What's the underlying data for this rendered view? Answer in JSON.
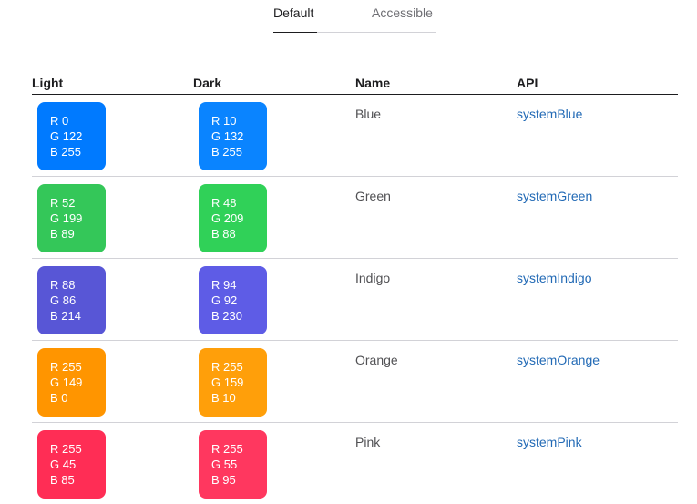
{
  "tabs": [
    {
      "label": "Default",
      "active": true
    },
    {
      "label": "Accessible",
      "active": false
    }
  ],
  "columns": {
    "light": "Light",
    "dark": "Dark",
    "name": "Name",
    "api": "API"
  },
  "colors": {
    "text_primary": "#1d1d1f",
    "text_secondary": "#515154",
    "link": "#2169b5",
    "divider": "#d2d2d7"
  },
  "rows": [
    {
      "name": "Blue",
      "api": "systemBlue",
      "light": {
        "hex": "#007aff",
        "r": "R 0",
        "g": "G 122",
        "b": "B 255"
      },
      "dark": {
        "hex": "#0a84ff",
        "r": "R 10",
        "g": "G 132",
        "b": "B 255"
      }
    },
    {
      "name": "Green",
      "api": "systemGreen",
      "light": {
        "hex": "#34c759",
        "r": "R 52",
        "g": "G 199",
        "b": "B 89"
      },
      "dark": {
        "hex": "#30d158",
        "r": "R 48",
        "g": "G 209",
        "b": "B 88"
      }
    },
    {
      "name": "Indigo",
      "api": "systemIndigo",
      "light": {
        "hex": "#5856d6",
        "r": "R 88",
        "g": "G 86",
        "b": "B 214"
      },
      "dark": {
        "hex": "#5e5ce6",
        "r": "R 94",
        "g": "G 92",
        "b": "B 230"
      }
    },
    {
      "name": "Orange",
      "api": "systemOrange",
      "light": {
        "hex": "#ff9500",
        "r": "R 255",
        "g": "G 149",
        "b": "B 0"
      },
      "dark": {
        "hex": "#ff9f0a",
        "r": "R 255",
        "g": "G 159",
        "b": "B 10"
      }
    },
    {
      "name": "Pink",
      "api": "systemPink",
      "light": {
        "hex": "#ff2d55",
        "r": "R 255",
        "g": "G 45",
        "b": "B 85"
      },
      "dark": {
        "hex": "#ff375f",
        "r": "R 255",
        "g": "G 55",
        "b": "B 95"
      }
    }
  ]
}
